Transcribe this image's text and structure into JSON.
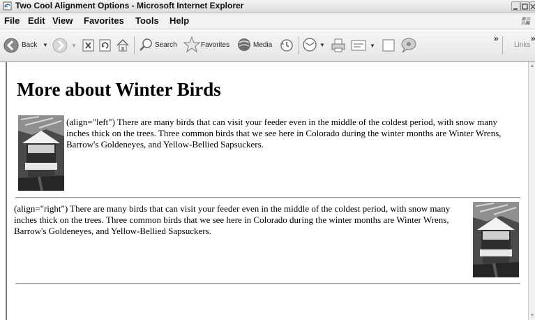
{
  "window": {
    "title": "Two Cool Alignment Options - Microsoft Internet Explorer"
  },
  "menu": [
    "File",
    "Edit",
    "View",
    "Favorites",
    "Tools",
    "Help"
  ],
  "toolbar": {
    "back_label": "Back",
    "search_label": "Search",
    "favorites_label": "Favorites",
    "media_label": "Media",
    "links_label": "Links",
    "overflow_label": "»"
  },
  "page": {
    "title": "More about Winter Birds",
    "para_left": "(align=\"left\") There are many birds that can visit your feeder even in the middle of the coldest period, with snow many inches thick on the trees. Three common birds that we see here in Colorado during the winter months are Winter Wrens, Barrow's Goldeneyes, and Yellow-Bellied Sapsuckers.",
    "para_right": "(align=\"right\") There are many birds that can visit your feeder even in the middle of the coldest period, with snow many inches thick on the trees. Three common birds that we see here in Colorado during the winter months are Winter Wrens, Barrow's Goldeneyes, and Yellow-Bellied Sapsuckers."
  },
  "icons": {
    "title": "ie-page-icon",
    "back": "back-arrow-icon",
    "forward": "forward-arrow-icon",
    "stop": "stop-icon",
    "refresh": "refresh-icon",
    "home": "home-icon",
    "search": "search-icon",
    "favorites": "favorites-star-icon",
    "media": "media-icon",
    "history": "history-icon",
    "mail": "mail-icon",
    "print": "print-icon",
    "edit": "edit-icon",
    "discuss": "discuss-icon",
    "messenger": "messenger-icon"
  }
}
